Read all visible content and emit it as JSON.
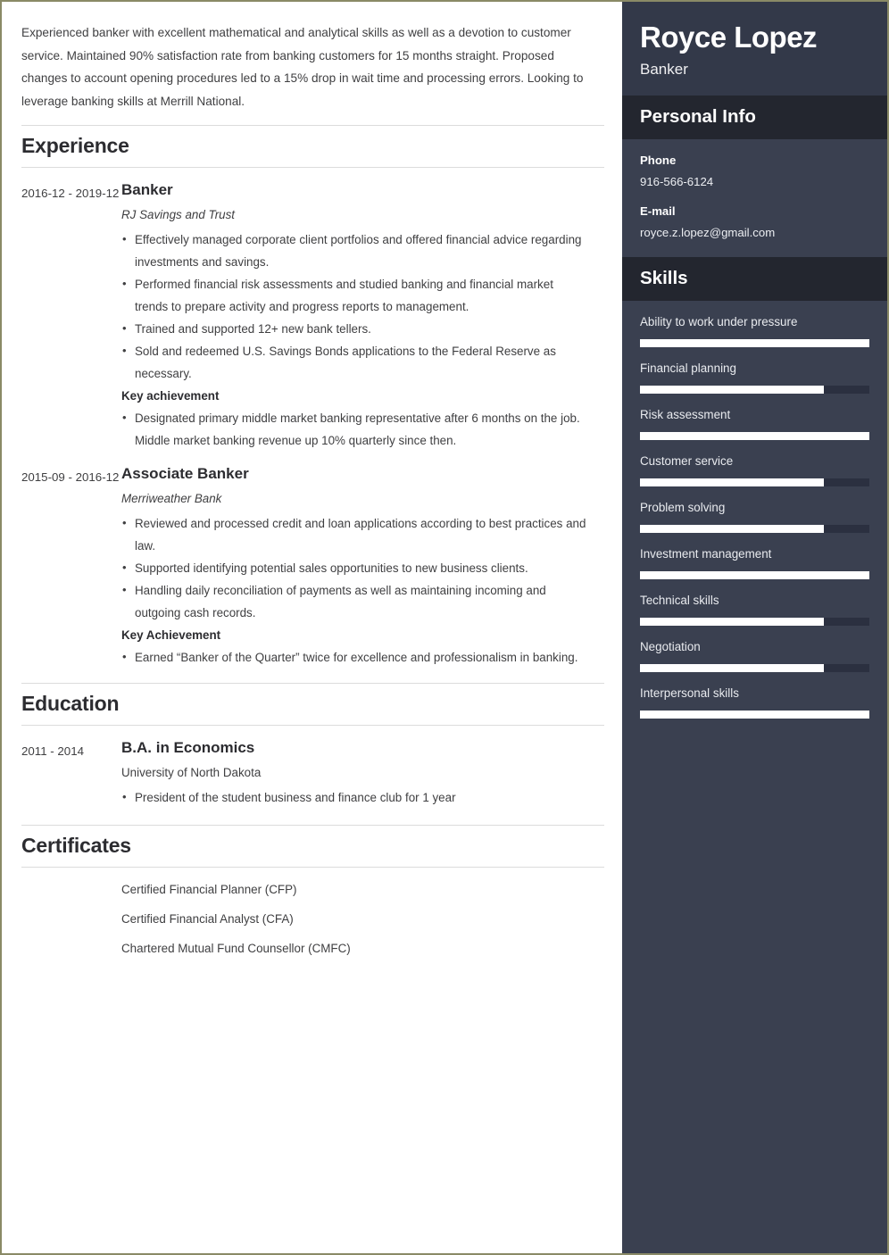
{
  "summary": "Experienced banker with excellent mathematical and analytical skills as well as a devotion to customer service. Maintained 90% satisfaction rate from banking customers for 15 months straight. Proposed changes to account opening procedures led to a 15% drop in wait time and processing errors. Looking to leverage banking skills at Merrill National.",
  "sections": {
    "experience": {
      "heading": "Experience",
      "entries": [
        {
          "dates": "2016-12 - 2019-12",
          "title": "Banker",
          "subtitle": "RJ Savings and Trust",
          "bullets": [
            "Effectively managed corporate client portfolios and offered financial advice regarding investments and savings.",
            "Performed financial risk assessments and studied banking and financial market trends to prepare activity and progress reports to management.",
            "Trained and supported 12+ new bank tellers.",
            "Sold and redeemed U.S. Savings Bonds applications to the Federal Reserve as necessary."
          ],
          "achievement_label": "Key achievement",
          "achievement_bullets": [
            "Designated primary middle market banking representative after 6 months on the job. Middle market banking revenue up 10% quarterly since then."
          ]
        },
        {
          "dates": "2015-09 - 2016-12",
          "title": "Associate Banker",
          "subtitle": "Merriweather Bank",
          "bullets": [
            "Reviewed and processed credit and loan applications according to best practices and law.",
            "Supported identifying potential sales opportunities to new business clients.",
            "Handling daily reconciliation of payments as well as maintaining incoming and outgoing cash records."
          ],
          "achievement_label": "Key Achievement",
          "achievement_bullets": [
            "Earned “Banker of the Quarter” twice for excellence and professionalism in banking."
          ]
        }
      ]
    },
    "education": {
      "heading": "Education",
      "entries": [
        {
          "dates": "2011 - 2014",
          "title": "B.A. in Economics",
          "subtitle": "University of North Dakota",
          "bullets": [
            "President of the student business and finance club for 1 year"
          ]
        }
      ]
    },
    "certificates": {
      "heading": "Certificates",
      "items": [
        "Certified Financial Planner (CFP)",
        "Certified Financial Analyst (CFA)",
        "Chartered Mutual Fund Counsellor (CMFC)"
      ]
    }
  },
  "sidebar": {
    "name": "Royce Lopez",
    "role": "Banker",
    "personal_info": {
      "heading": "Personal Info",
      "items": [
        {
          "label": "Phone",
          "value": "916-566-6124"
        },
        {
          "label": "E-mail",
          "value": "royce.z.lopez@gmail.com"
        }
      ]
    },
    "skills": {
      "heading": "Skills",
      "items": [
        {
          "name": "Ability to work under pressure",
          "level": 100
        },
        {
          "name": "Financial planning",
          "level": 80
        },
        {
          "name": "Risk assessment",
          "level": 100
        },
        {
          "name": "Customer service",
          "level": 80
        },
        {
          "name": "Problem solving",
          "level": 80
        },
        {
          "name": "Investment management",
          "level": 100
        },
        {
          "name": "Technical skills",
          "level": 80
        },
        {
          "name": "Negotiation",
          "level": 80
        },
        {
          "name": "Interpersonal skills",
          "level": 100
        }
      ]
    }
  },
  "colors": {
    "sidebar_bg": "#3a4050",
    "sidebar_identity_bg": "#333949",
    "sidebar_band_bg": "#23262f",
    "skill_fill": "#ffffff",
    "skill_track": "#2b3040",
    "page_border": "#8a8a66",
    "text": "#3f3f41",
    "heading": "#2c2c30",
    "rule": "#dcdcdc"
  }
}
